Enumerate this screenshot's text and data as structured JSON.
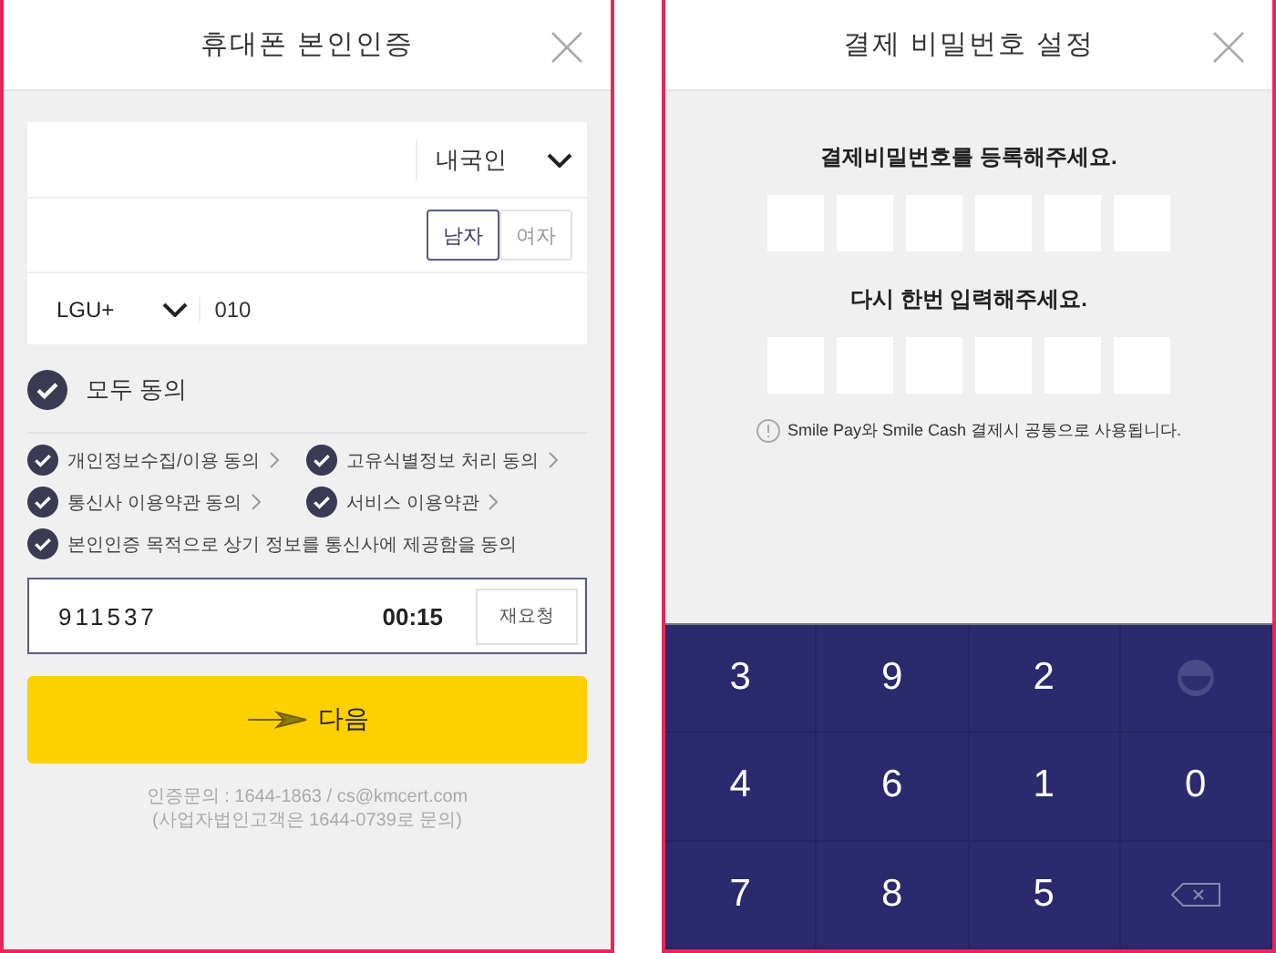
{
  "left": {
    "title": "휴대폰 본인인증",
    "nationality": "내국인",
    "gender": [
      {
        "label": "남자",
        "selected": true
      },
      {
        "label": "여자",
        "selected": false
      }
    ],
    "carrier": "LGU+",
    "phone_prefix": "010",
    "agree_all": {
      "label": "모두 동의",
      "checked": true
    },
    "agreements": [
      {
        "label": "개인정보수집/이용 동의",
        "checked": true,
        "has_detail": true
      },
      {
        "label": "고유식별정보 처리 동의",
        "checked": true,
        "has_detail": true
      },
      {
        "label": "통신사 이용약관 동의",
        "checked": true,
        "has_detail": true
      },
      {
        "label": "서비스 이용약관",
        "checked": true,
        "has_detail": true
      },
      {
        "label": "본인인증 목적으로 상기 정보를 통신사에 제공함을 동의",
        "checked": true,
        "has_detail": false
      }
    ],
    "code": "911537",
    "timer": "00:15",
    "resend": "재요청",
    "next": "다음",
    "footer": [
      "인증문의 : 1644-1863 / cs@kmcert.com",
      "(사업자법인고객은 1644-0739로 문의)"
    ]
  },
  "right": {
    "title": "결제 비밀번호 설정",
    "prompt": "결제비밀번호를 등록해주세요.",
    "pin_boxes": [
      {
        "filled": false
      },
      {
        "filled": false
      },
      {
        "filled": false
      },
      {
        "filled": false
      },
      {
        "filled": false
      },
      {
        "filled": false
      }
    ],
    "confirm_prompt": "다시 한번 입력해주세요.",
    "confirm_boxes": [
      {
        "filled": false
      },
      {
        "filled": false
      },
      {
        "filled": false
      },
      {
        "filled": false
      },
      {
        "filled": false
      },
      {
        "filled": false
      }
    ],
    "notice": "Smile Pay와 Smile Cash 결제시 공통으로 사용됩니다.",
    "keys": [
      {
        "kind": "digit",
        "label": "3"
      },
      {
        "kind": "digit",
        "label": "9"
      },
      {
        "kind": "digit",
        "label": "2"
      },
      {
        "kind": "logo"
      },
      {
        "kind": "digit",
        "label": "4"
      },
      {
        "kind": "digit",
        "label": "6"
      },
      {
        "kind": "digit",
        "label": "1"
      },
      {
        "kind": "digit",
        "label": "0"
      },
      {
        "kind": "digit",
        "label": "7"
      },
      {
        "kind": "digit",
        "label": "8"
      },
      {
        "kind": "digit",
        "label": "5"
      },
      {
        "kind": "backspace"
      }
    ]
  }
}
